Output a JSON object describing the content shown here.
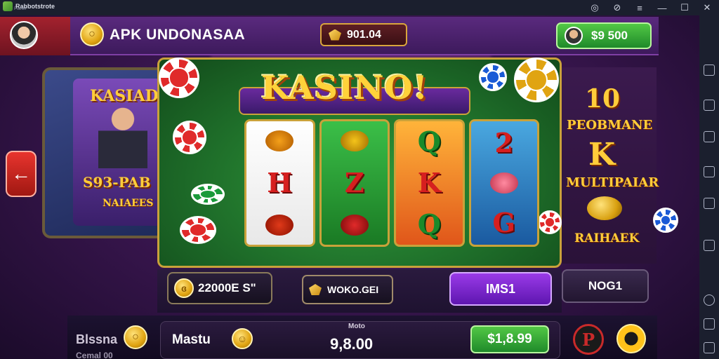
{
  "emulator": {
    "brand": "Rabbotstrote",
    "brand_sub": "Planet",
    "controls": [
      "help-icon",
      "settings-icon",
      "menu-icon",
      "minimize-icon",
      "maximize-icon",
      "close-icon"
    ]
  },
  "header": {
    "app_title": "APK UNDONASAA",
    "gems": "901.04",
    "cash": "$9 500"
  },
  "left_poster": {
    "title": "KASIADU",
    "line1": "S93-PAB",
    "line2": "NAIAEES"
  },
  "game": {
    "logo": "KASINO!",
    "reels": [
      {
        "color": "white",
        "symbols": [
          "fruit",
          "H",
          "fruit"
        ]
      },
      {
        "color": "green",
        "symbols": [
          "fruit",
          "Z",
          "fruit"
        ]
      },
      {
        "color": "orange",
        "symbols": [
          "Q",
          "K",
          "Q"
        ]
      },
      {
        "color": "blue",
        "symbols": [
          "2",
          "fruit",
          "G"
        ]
      }
    ]
  },
  "right_panel": {
    "line1": "10",
    "line2": "PEOBMANE",
    "line3": "K",
    "line4": "MULTIPAIAR",
    "line5": "RAIHAEK"
  },
  "controls": {
    "balance": "22000E S\"",
    "win_label": "WOKO.GEI",
    "spin_label": "IMS1",
    "side_label": "NOG1"
  },
  "bottom": {
    "left_label": "Blssna",
    "left_label2": "Cemal 00",
    "label": "Mastu",
    "mini_label": "Moto",
    "amount": "9,8.00",
    "bet_label": "$1,8.99",
    "logo_letter": "P"
  },
  "colors": {
    "accent_purple": "#5e16b0",
    "accent_green": "#1f8a2a",
    "gold": "#ffcd3a",
    "felt": "#1d6a28"
  }
}
